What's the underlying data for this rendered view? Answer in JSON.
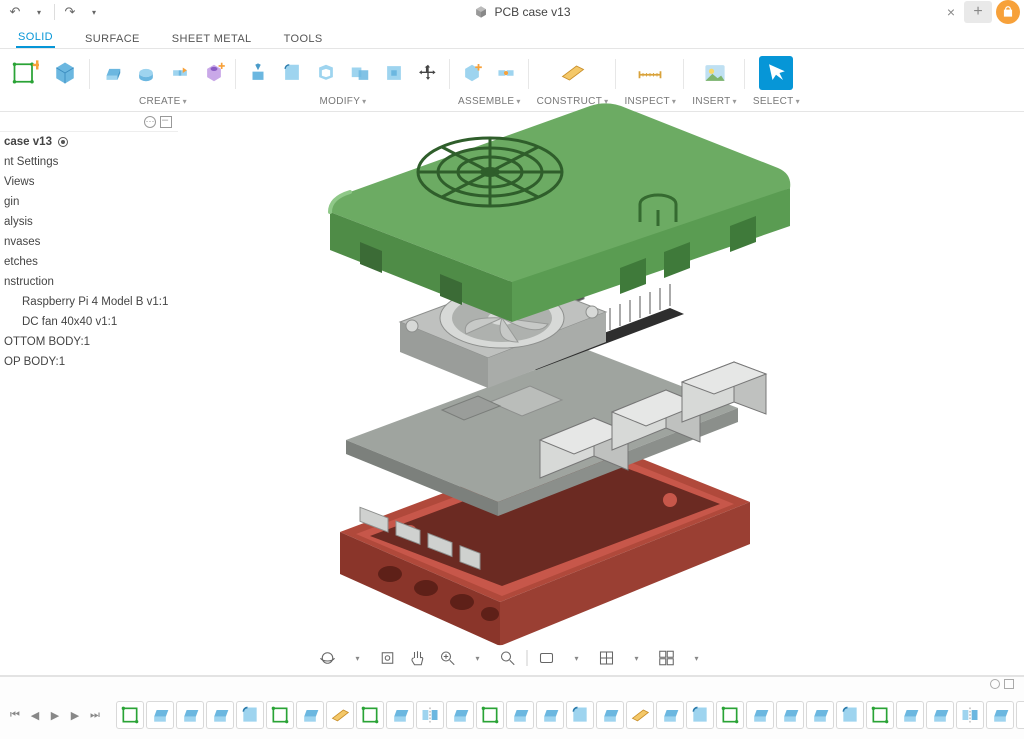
{
  "document_title": "PCB case v13",
  "ribbon_tabs": [
    "SOLID",
    "SURFACE",
    "SHEET METAL",
    "TOOLS"
  ],
  "active_ribbon_tab": 0,
  "toolbar_groups": {
    "design": {
      "label": ""
    },
    "create": {
      "label": "CREATE"
    },
    "modify": {
      "label": "MODIFY"
    },
    "assemble": {
      "label": "ASSEMBLE"
    },
    "construct": {
      "label": "CONSTRUCT"
    },
    "inspect": {
      "label": "INSPECT"
    },
    "insert": {
      "label": "INSERT"
    },
    "select": {
      "label": "SELECT"
    }
  },
  "browser": {
    "root": "case v13",
    "nodes": [
      "nt Settings",
      "Views",
      "gin",
      "alysis",
      "nvases",
      "etches",
      "nstruction"
    ],
    "construction_children": [
      "Raspberry Pi 4 Model B v1:1",
      "DC fan 40x40 v1:1"
    ],
    "bodies": [
      "OTTOM BODY:1",
      "OP BODY:1"
    ]
  },
  "navbar_tools": [
    "orbit",
    "look",
    "pan",
    "zoom",
    "fit",
    "display",
    "grid",
    "viewports"
  ],
  "timeline_count": 33,
  "colors": {
    "accent": "#0696d7",
    "lid": "#5a9c52",
    "lid_dark": "#3f7a3a",
    "board_body": "#b9bab9",
    "board_dark": "#8d8f8d",
    "base": "#b0493b",
    "base_dark": "#8a352a",
    "metal": "#cfd1cf"
  }
}
